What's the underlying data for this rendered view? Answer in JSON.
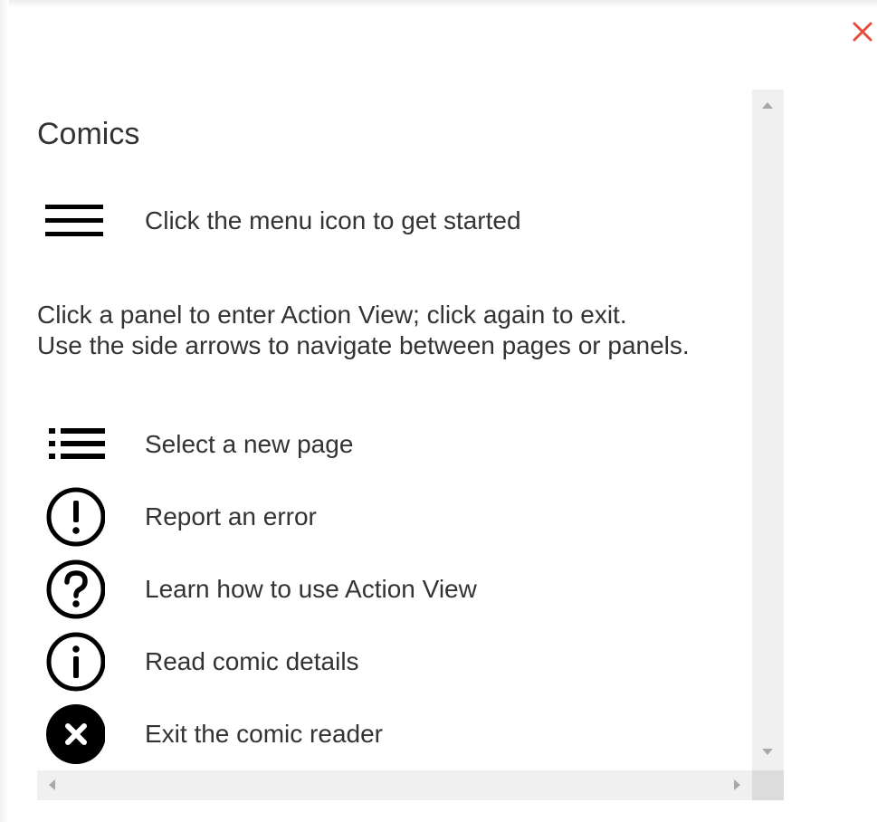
{
  "dialog": {
    "close_icon": "close-icon",
    "close_color": "#e74c3c",
    "title": "Comics",
    "menu_hint": {
      "icon": "hamburger-menu-icon",
      "label": "Click the menu icon to get started"
    },
    "instructions": [
      "Click a panel to enter Action View; click again to exit.",
      "Use the side arrows to navigate between pages or panels."
    ],
    "legend": [
      {
        "icon": "page-list-icon",
        "label": "Select a new page"
      },
      {
        "icon": "exclamation-circle-icon",
        "label": "Report an error"
      },
      {
        "icon": "question-circle-icon",
        "label": "Learn how to use Action View"
      },
      {
        "icon": "info-circle-icon",
        "label": "Read comic details"
      },
      {
        "icon": "close-circle-icon",
        "label": "Exit the comic reader"
      }
    ]
  },
  "colors": {
    "text": "#333333",
    "icon": "#000000",
    "scrollbar_track": "#f0f0f0",
    "scrollbar_arrow": "#a8a8a8"
  }
}
